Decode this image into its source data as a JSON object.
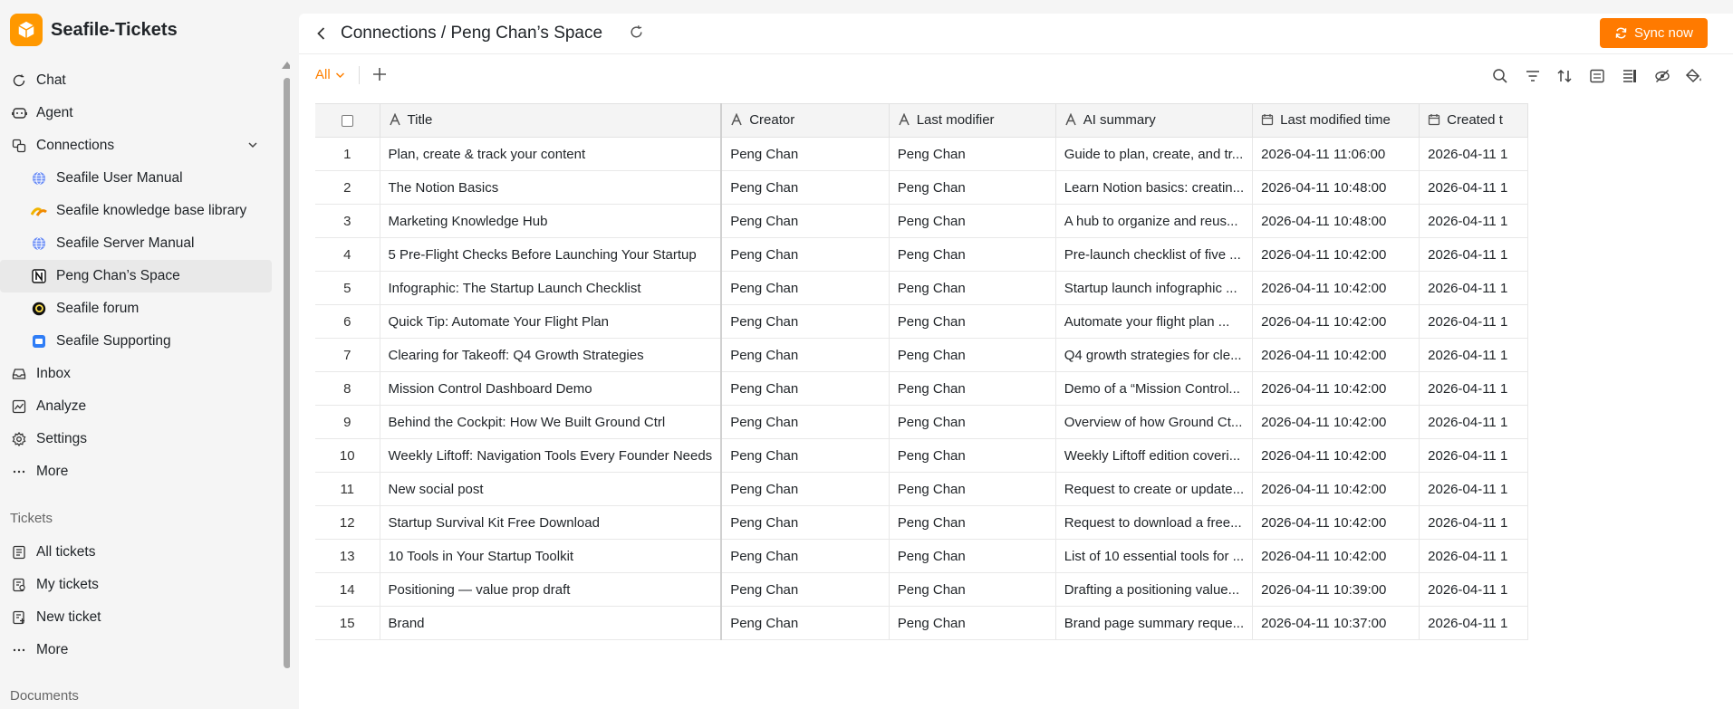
{
  "app": {
    "name": "Seafile-Tickets",
    "accent": "#ff8000"
  },
  "sidebar": {
    "nav": [
      {
        "label": "Chat",
        "icon": "chat-icon"
      },
      {
        "label": "Agent",
        "icon": "agent-icon"
      },
      {
        "label": "Connections",
        "icon": "connections-icon"
      }
    ],
    "connections": [
      {
        "label": "Seafile User Manual",
        "icon": "globe-icon"
      },
      {
        "label": "Seafile knowledge base library",
        "icon": "library-icon"
      },
      {
        "label": "Seafile Server Manual",
        "icon": "globe-icon"
      },
      {
        "label": "Peng Chan’s Space",
        "icon": "notion-icon"
      },
      {
        "label": "Seafile forum",
        "icon": "discourse-icon"
      },
      {
        "label": "Seafile Supporting",
        "icon": "support-icon"
      }
    ],
    "nav2": [
      {
        "label": "Inbox",
        "icon": "inbox-icon"
      },
      {
        "label": "Analyze",
        "icon": "analyze-icon"
      },
      {
        "label": "Settings",
        "icon": "settings-icon"
      },
      {
        "label": "More",
        "icon": "more-icon"
      }
    ],
    "tickets_label": "Tickets",
    "tickets": [
      {
        "label": "All tickets",
        "icon": "list-icon"
      },
      {
        "label": "My tickets",
        "icon": "my-tickets-icon"
      },
      {
        "label": "New ticket",
        "icon": "new-ticket-icon"
      },
      {
        "label": "More",
        "icon": "more-icon"
      }
    ],
    "documents_label": "Documents"
  },
  "header": {
    "breadcrumb": "Connections / Peng Chan’s Space",
    "sync_label": "Sync now"
  },
  "toolbar": {
    "view": "All"
  },
  "table": {
    "columns": [
      "Title",
      "Creator",
      "Last modifier",
      "AI summary",
      "Last modified time",
      "Created t"
    ],
    "rows": [
      {
        "n": "1",
        "title": "Plan, create & track your content",
        "creator": "Peng Chan",
        "modifier": "Peng Chan",
        "summary": "Guide to plan, create, and tr...",
        "modified": "2026-04-11 11:06:00",
        "created": "2026-04-11 1"
      },
      {
        "n": "2",
        "title": "The Notion Basics",
        "creator": "Peng Chan",
        "modifier": "Peng Chan",
        "summary": "Learn Notion basics: creatin...",
        "modified": "2026-04-11 10:48:00",
        "created": "2026-04-11 1"
      },
      {
        "n": "3",
        "title": "Marketing Knowledge Hub",
        "creator": "Peng Chan",
        "modifier": "Peng Chan",
        "summary": "A hub to organize and reus...",
        "modified": "2026-04-11 10:48:00",
        "created": "2026-04-11 1"
      },
      {
        "n": "4",
        "title": "5 Pre-Flight Checks Before Launching Your Startup",
        "creator": "Peng Chan",
        "modifier": "Peng Chan",
        "summary": "Pre-launch checklist of five ...",
        "modified": "2026-04-11 10:42:00",
        "created": "2026-04-11 1"
      },
      {
        "n": "5",
        "title": "Infographic: The Startup Launch Checklist",
        "creator": "Peng Chan",
        "modifier": "Peng Chan",
        "summary": "Startup launch infographic ...",
        "modified": "2026-04-11 10:42:00",
        "created": "2026-04-11 1"
      },
      {
        "n": "6",
        "title": "Quick Tip: Automate Your Flight Plan",
        "creator": "Peng Chan",
        "modifier": "Peng Chan",
        "summary": "Automate your flight plan ...",
        "modified": "2026-04-11 10:42:00",
        "created": "2026-04-11 1"
      },
      {
        "n": "7",
        "title": "Clearing for Takeoff: Q4 Growth Strategies",
        "creator": "Peng Chan",
        "modifier": "Peng Chan",
        "summary": "Q4 growth strategies for cle...",
        "modified": "2026-04-11 10:42:00",
        "created": "2026-04-11 1"
      },
      {
        "n": "8",
        "title": "Mission Control Dashboard Demo",
        "creator": "Peng Chan",
        "modifier": "Peng Chan",
        "summary": "Demo of a “Mission Control...",
        "modified": "2026-04-11 10:42:00",
        "created": "2026-04-11 1"
      },
      {
        "n": "9",
        "title": "Behind the Cockpit: How We Built Ground Ctrl",
        "creator": "Peng Chan",
        "modifier": "Peng Chan",
        "summary": "Overview of how Ground Ct...",
        "modified": "2026-04-11 10:42:00",
        "created": "2026-04-11 1"
      },
      {
        "n": "10",
        "title": "Weekly Liftoff: Navigation Tools Every Founder Needs",
        "creator": "Peng Chan",
        "modifier": "Peng Chan",
        "summary": "Weekly Liftoff edition coveri...",
        "modified": "2026-04-11 10:42:00",
        "created": "2026-04-11 1"
      },
      {
        "n": "11",
        "title": "New social post",
        "creator": "Peng Chan",
        "modifier": "Peng Chan",
        "summary": "Request to create or update...",
        "modified": "2026-04-11 10:42:00",
        "created": "2026-04-11 1"
      },
      {
        "n": "12",
        "title": "Startup Survival Kit Free Download",
        "creator": "Peng Chan",
        "modifier": "Peng Chan",
        "summary": "Request to download a free...",
        "modified": "2026-04-11 10:42:00",
        "created": "2026-04-11 1"
      },
      {
        "n": "13",
        "title": "10 Tools in Your Startup Toolkit",
        "creator": "Peng Chan",
        "modifier": "Peng Chan",
        "summary": "List of 10 essential tools for ...",
        "modified": "2026-04-11 10:42:00",
        "created": "2026-04-11 1"
      },
      {
        "n": "14",
        "title": "Positioning — value prop draft",
        "creator": "Peng Chan",
        "modifier": "Peng Chan",
        "summary": "Drafting a positioning value...",
        "modified": "2026-04-11 10:39:00",
        "created": "2026-04-11 1"
      },
      {
        "n": "15",
        "title": "Brand",
        "creator": "Peng Chan",
        "modifier": "Peng Chan",
        "summary": "Brand page summary reque...",
        "modified": "2026-04-11 10:37:00",
        "created": "2026-04-11 1"
      }
    ]
  }
}
